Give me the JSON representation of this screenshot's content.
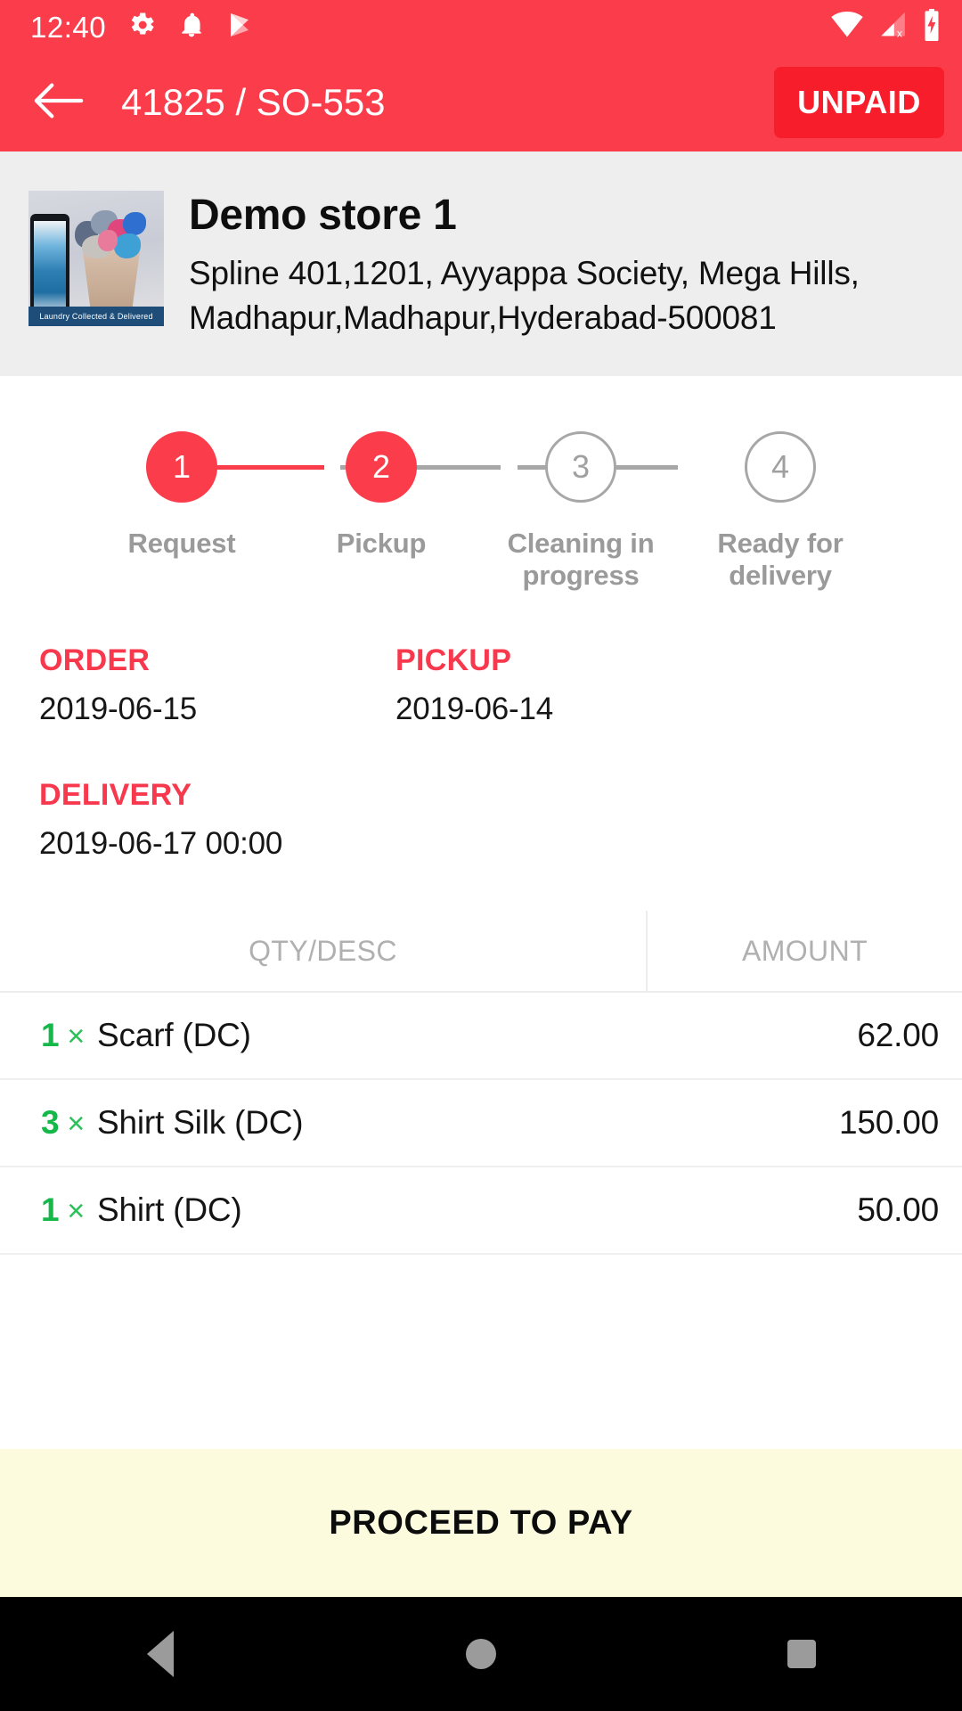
{
  "status_bar": {
    "time": "12:40",
    "left_icons": [
      "gear-icon",
      "bell-icon",
      "play-store-icon"
    ],
    "right_icons": [
      "wifi-icon",
      "cellular-no-signal-icon",
      "battery-charging-icon"
    ]
  },
  "app_bar": {
    "back_icon": "arrow-left-icon",
    "title": "41825 / SO-553",
    "payment_status": "UNPAID",
    "bg_color": "#fa3c4b",
    "badge_color": "#f71d2a"
  },
  "store": {
    "name": "Demo store 1",
    "address": "Spline 401,1201, Ayyappa Society, Mega Hills, Madhapur,Madhapur,Hyderabad-500081",
    "thumbnail_caption": "Laundry Collected & Delivered"
  },
  "stepper": {
    "active_color": "#fa3c4b",
    "inactive_color": "#a7a7a7",
    "steps": [
      {
        "number": "1",
        "label": "Request",
        "done": true
      },
      {
        "number": "2",
        "label": "Pickup",
        "done": true
      },
      {
        "number": "3",
        "label": "Cleaning in progress",
        "done": false
      },
      {
        "number": "4",
        "label": "Ready for delivery",
        "done": false
      }
    ]
  },
  "dates": {
    "label_color": "#f7384d",
    "order": {
      "label": "ORDER",
      "value": "2019-06-15"
    },
    "pickup": {
      "label": "PICKUP",
      "value": "2019-06-14"
    },
    "delivery": {
      "label": "DELIVERY",
      "value": "2019-06-17 00:00"
    }
  },
  "items_table": {
    "headers": {
      "qty_desc": "QTY/DESC",
      "amount": "AMOUNT"
    },
    "qty_color": "#16b84a",
    "rows": [
      {
        "qty": "1",
        "times": "×",
        "desc": "Scarf (DC)",
        "amount": "62.00"
      },
      {
        "qty": "3",
        "times": "×",
        "desc": "Shirt Silk (DC)",
        "amount": "150.00"
      },
      {
        "qty": "1",
        "times": "×",
        "desc": "Shirt (DC)",
        "amount": "50.00"
      }
    ]
  },
  "proceed_bar": {
    "label": "PROCEED TO PAY",
    "bg_color": "#fcfbdd"
  },
  "nav_bar": {
    "buttons": [
      "back-triangle-icon",
      "home-circle-icon",
      "recents-square-icon"
    ]
  }
}
